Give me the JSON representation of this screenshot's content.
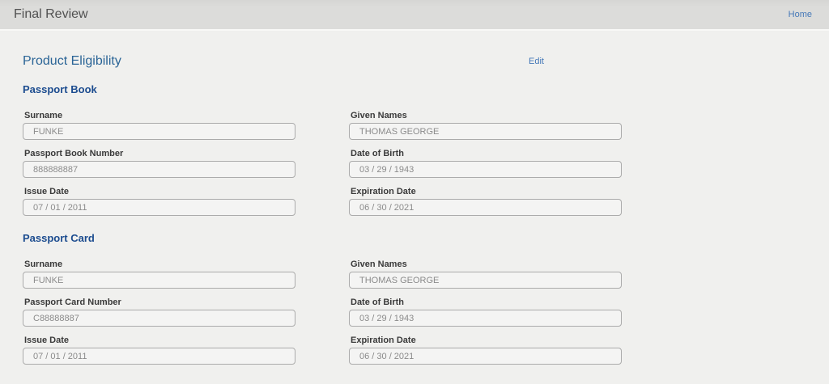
{
  "header": {
    "title": "Final Review",
    "home_label": "Home"
  },
  "page": {
    "title": "Product Eligibility",
    "edit_label": "Edit"
  },
  "interface_colors": {
    "page_title_blue": "#2a6496",
    "section_title_blue": "#1c4c8f",
    "link_blue": "#4679b8",
    "header_bar_gray": "#dcdcda",
    "page_background": "#f0f0ee",
    "input_background": "#f4f4f3",
    "input_border": "#ababab",
    "input_text": "#8b8b8b"
  },
  "sections": [
    {
      "title": "Passport Book",
      "fields": [
        {
          "label": "Surname",
          "value": "FUNKE"
        },
        {
          "label": "Given Names",
          "value": "THOMAS GEORGE"
        },
        {
          "label": "Passport Book Number",
          "value": "888888887"
        },
        {
          "label": "Date of Birth",
          "value": "03 / 29 / 1943"
        },
        {
          "label": "Issue Date",
          "value": "07 / 01 / 2011"
        },
        {
          "label": "Expiration Date",
          "value": "06 / 30 / 2021"
        }
      ]
    },
    {
      "title": "Passport Card",
      "fields": [
        {
          "label": "Surname",
          "value": "FUNKE"
        },
        {
          "label": "Given Names",
          "value": "THOMAS GEORGE"
        },
        {
          "label": "Passport Card Number",
          "value": "C88888887"
        },
        {
          "label": "Date of Birth",
          "value": "03 / 29 / 1943"
        },
        {
          "label": "Issue Date",
          "value": "07 / 01 / 2011"
        },
        {
          "label": "Expiration Date",
          "value": "06 / 30 / 2021"
        }
      ]
    }
  ]
}
